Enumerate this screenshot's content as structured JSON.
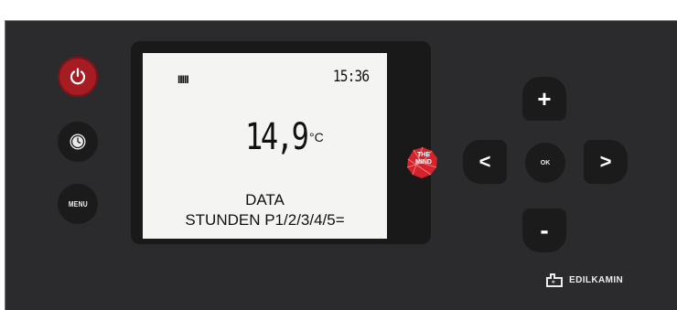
{
  "buttons": {
    "menu_label": "MENU",
    "ok_label": "OK",
    "up_label": "+",
    "down_label": "-",
    "left_label": "<",
    "right_label": ">"
  },
  "display": {
    "bars": "IIIII",
    "time": "15:36",
    "temperature": "14,9",
    "unit": "°C",
    "line1": "DATA",
    "line2": "STUNDEN P1/2/3/4/5="
  },
  "logo": {
    "mind_line1": "THE",
    "mind_line2": "MIND",
    "brand": "EDILKAMIN"
  },
  "colors": {
    "panel": "#2b2b2d",
    "power_button": "#a51d22",
    "mind_logo": "#d6232b",
    "lcd_background": "#f4f4f2"
  }
}
